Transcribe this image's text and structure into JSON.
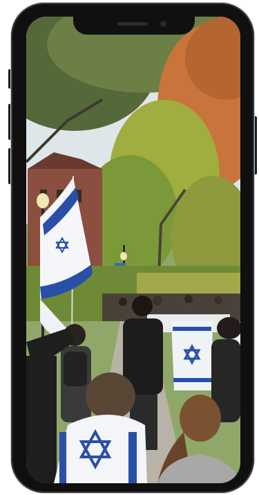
{
  "scene": {
    "subject": "photo",
    "colors": {
      "phone_frame": "#101010",
      "flag_blue": "#2a4fa8",
      "flag_white": "#f4f6fa",
      "foliage_green": "#7f9a3a",
      "foliage_orange": "#c9743a",
      "sky": "#dfe6ea"
    }
  }
}
